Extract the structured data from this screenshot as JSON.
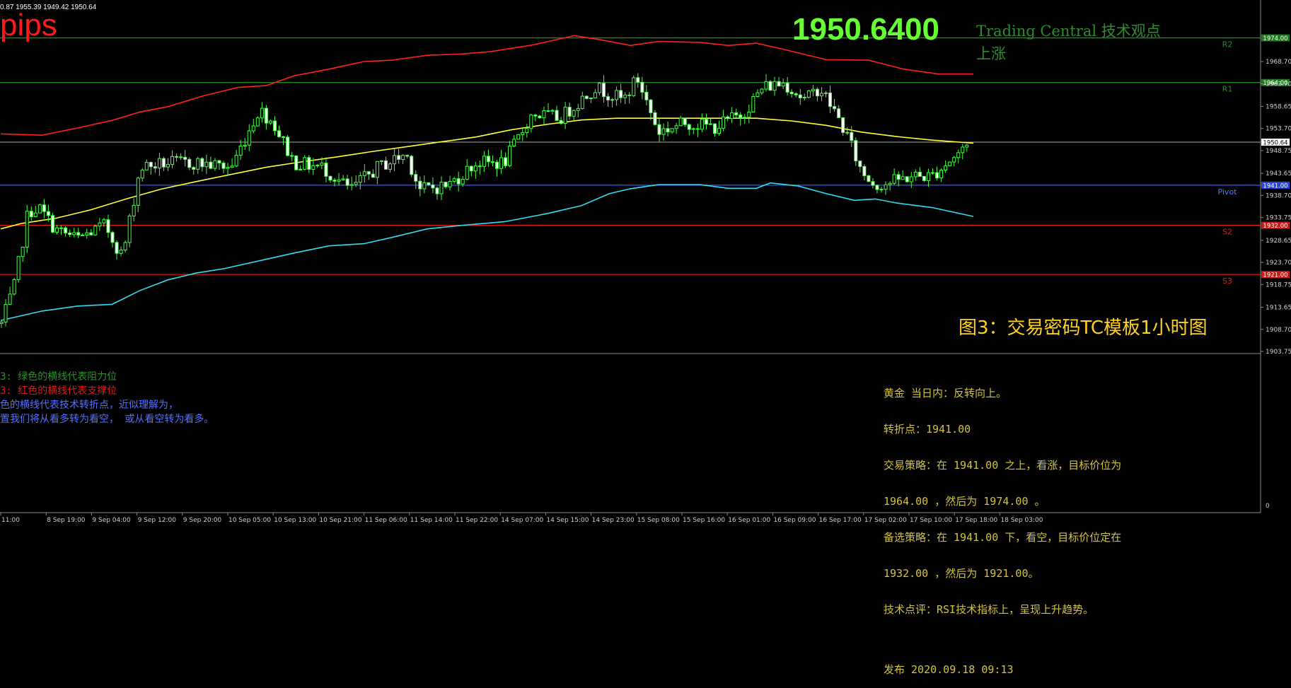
{
  "header": {
    "ohlc": "0.87 1955.39 1949.42 1950.64",
    "pips": "pips",
    "big_price": "1950.6400",
    "tc_title": "Trading Central 技术观点",
    "tc_direction": "上涨"
  },
  "caption": "图3：交易密码TC模板1小时图",
  "legend": [
    "3: 绿色的横线代表阻力位",
    "3: 红色的横线代表支撑位",
    "色的横线代表技术转折点，近似理解为，",
    "置我们将从看多转为看空， 或从看空转为看多。"
  ],
  "analysis": {
    "line1": "黄金 当日内：反转向上。",
    "line2": "转折点：1941.00",
    "line3": "交易策略：在 1941.00 之上，看涨，目标价位为",
    "line4": "1964.00 ，然后为 1974.00 。",
    "line5": "备选策略：在 1941.00 下，看空，目标价位定在",
    "line6": "1932.00 ，然后为 1921.00。",
    "line7": "技术点评：RSI技术指标上，呈现上升趋势。",
    "line8": "",
    "line9": "发布 2020.09.18 09:13"
  },
  "colors": {
    "resistance": "#1a8c1a",
    "support": "#e01010",
    "pivot": "#3355ff",
    "upper_band": "#ff2020",
    "middle_ma": "#ffff33",
    "lower_band": "#33ddee",
    "candle": "#44ff44",
    "price_line": "#aaaaaa"
  },
  "chart_data": {
    "type": "candlestick",
    "ylim": [
      1903.75,
      1979.0
    ],
    "y_ticks": [
      "1968.70",
      "1963.70",
      "1958.65",
      "1953.70",
      "1948.75",
      "1943.65",
      "1938.70",
      "1933.75",
      "1928.65",
      "1923.70",
      "1918.75",
      "1913.65",
      "1908.70",
      "1903.75"
    ],
    "x_ticks": [
      "11:00",
      "8 Sep 19:00",
      "9 Sep 04:00",
      "9 Sep 12:00",
      "9 Sep 20:00",
      "10 Sep 05:00",
      "10 Sep 13:00",
      "10 Sep 21:00",
      "11 Sep 06:00",
      "11 Sep 14:00",
      "11 Sep 22:00",
      "14 Sep 07:00",
      "14 Sep 15:00",
      "14 Sep 23:00",
      "15 Sep 08:00",
      "15 Sep 16:00",
      "16 Sep 01:00",
      "16 Sep 09:00",
      "16 Sep 17:00",
      "17 Sep 02:00",
      "17 Sep 10:00",
      "17 Sep 18:00",
      "18 Sep 03:00"
    ],
    "levels": [
      {
        "name": "R2",
        "value": 1974.0,
        "kind": "resistance",
        "tag": "1974.00"
      },
      {
        "name": "R1",
        "value": 1964.0,
        "kind": "resistance",
        "tag": "1964.00"
      },
      {
        "name": "Pivot",
        "value": 1941.0,
        "kind": "pivot",
        "tag": "1941.00"
      },
      {
        "name": "S2",
        "value": 1932.0,
        "kind": "support",
        "tag": "1932.00"
      },
      {
        "name": "S3",
        "value": 1921.0,
        "kind": "support",
        "tag": "1921.00"
      }
    ],
    "current_price": {
      "value": 1950.64,
      "tag": "1950.64"
    },
    "indicator_zero": "0",
    "upper_band": [
      [
        1,
        1952.5
      ],
      [
        60,
        1952.2
      ],
      [
        110,
        1953.8
      ],
      [
        160,
        1955.5
      ],
      [
        200,
        1957.4
      ],
      [
        240,
        1958.6
      ],
      [
        290,
        1961.0
      ],
      [
        340,
        1962.9
      ],
      [
        380,
        1963.3
      ],
      [
        420,
        1965.5
      ],
      [
        470,
        1967.0
      ],
      [
        520,
        1968.7
      ],
      [
        560,
        1969.0
      ],
      [
        610,
        1970.1
      ],
      [
        660,
        1970.4
      ],
      [
        700,
        1970.9
      ],
      [
        760,
        1972.4
      ],
      [
        820,
        1974.5
      ],
      [
        860,
        1973.5
      ],
      [
        900,
        1972.3
      ],
      [
        940,
        1973.2
      ],
      [
        1000,
        1973.0
      ],
      [
        1040,
        1972.3
      ],
      [
        1080,
        1972.8
      ],
      [
        1120,
        1971.4
      ],
      [
        1180,
        1969.1
      ],
      [
        1240,
        1969.0
      ],
      [
        1290,
        1967.0
      ],
      [
        1340,
        1965.9
      ],
      [
        1390,
        1965.9
      ]
    ],
    "middle_ma": [
      [
        1,
        1931.2
      ],
      [
        30,
        1932.4
      ],
      [
        80,
        1933.6
      ],
      [
        130,
        1935.5
      ],
      [
        180,
        1937.9
      ],
      [
        230,
        1940.1
      ],
      [
        280,
        1941.8
      ],
      [
        330,
        1943.4
      ],
      [
        380,
        1945.0
      ],
      [
        430,
        1946.2
      ],
      [
        480,
        1947.3
      ],
      [
        530,
        1948.5
      ],
      [
        580,
        1949.6
      ],
      [
        630,
        1950.7
      ],
      [
        680,
        1951.8
      ],
      [
        730,
        1953.4
      ],
      [
        780,
        1954.6
      ],
      [
        830,
        1955.6
      ],
      [
        880,
        1956.0
      ],
      [
        930,
        1956.0
      ],
      [
        980,
        1956.0
      ],
      [
        1030,
        1956.0
      ],
      [
        1080,
        1956.0
      ],
      [
        1130,
        1955.4
      ],
      [
        1180,
        1954.4
      ],
      [
        1230,
        1952.9
      ],
      [
        1280,
        1951.9
      ],
      [
        1330,
        1951.1
      ],
      [
        1390,
        1950.4
      ]
    ],
    "lower_band": [
      [
        1,
        1910.7
      ],
      [
        60,
        1912.8
      ],
      [
        110,
        1913.9
      ],
      [
        160,
        1914.3
      ],
      [
        200,
        1917.4
      ],
      [
        240,
        1919.8
      ],
      [
        280,
        1921.3
      ],
      [
        320,
        1922.3
      ],
      [
        380,
        1924.4
      ],
      [
        420,
        1925.8
      ],
      [
        470,
        1927.4
      ],
      [
        520,
        1927.9
      ],
      [
        560,
        1929.3
      ],
      [
        610,
        1931.2
      ],
      [
        660,
        1932.0
      ],
      [
        720,
        1932.8
      ],
      [
        780,
        1934.6
      ],
      [
        830,
        1936.4
      ],
      [
        870,
        1939.1
      ],
      [
        900,
        1940.2
      ],
      [
        940,
        1941.1
      ],
      [
        1000,
        1941.1
      ],
      [
        1040,
        1940.3
      ],
      [
        1080,
        1940.3
      ],
      [
        1100,
        1941.5
      ],
      [
        1140,
        1940.8
      ],
      [
        1180,
        1939.1
      ],
      [
        1220,
        1937.6
      ],
      [
        1250,
        1937.9
      ],
      [
        1280,
        1937.0
      ],
      [
        1330,
        1936.0
      ],
      [
        1390,
        1934.0
      ]
    ]
  }
}
